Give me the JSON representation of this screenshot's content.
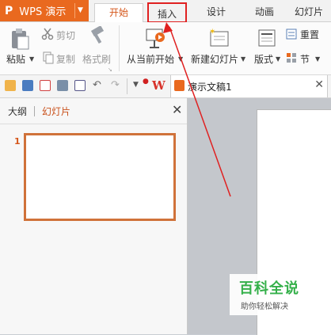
{
  "app": {
    "logo": "P",
    "name": "WPS 演示",
    "brand_color": "#e9691f"
  },
  "tabs": [
    {
      "label": "开始"
    },
    {
      "label": "插入"
    },
    {
      "label": "设计"
    },
    {
      "label": "动画"
    },
    {
      "label": "幻灯片放"
    }
  ],
  "ribbon": {
    "paste": "粘贴",
    "cut": "剪切",
    "copy": "复制",
    "format_painter": "格式刷",
    "from_current": "从当前开始",
    "new_slide": "新建幻灯片",
    "layout": "版式",
    "reset": "重置",
    "section": "节"
  },
  "qat": {
    "doc_title": "演示文稿1"
  },
  "left_pane": {
    "tab_outline": "大纲",
    "tab_slides": "幻灯片",
    "slide_number": "1"
  },
  "watermark": {
    "title": "百科全说",
    "subtitle": "助你轻松解决"
  },
  "annotation": {
    "highlight_color": "#e02020"
  }
}
